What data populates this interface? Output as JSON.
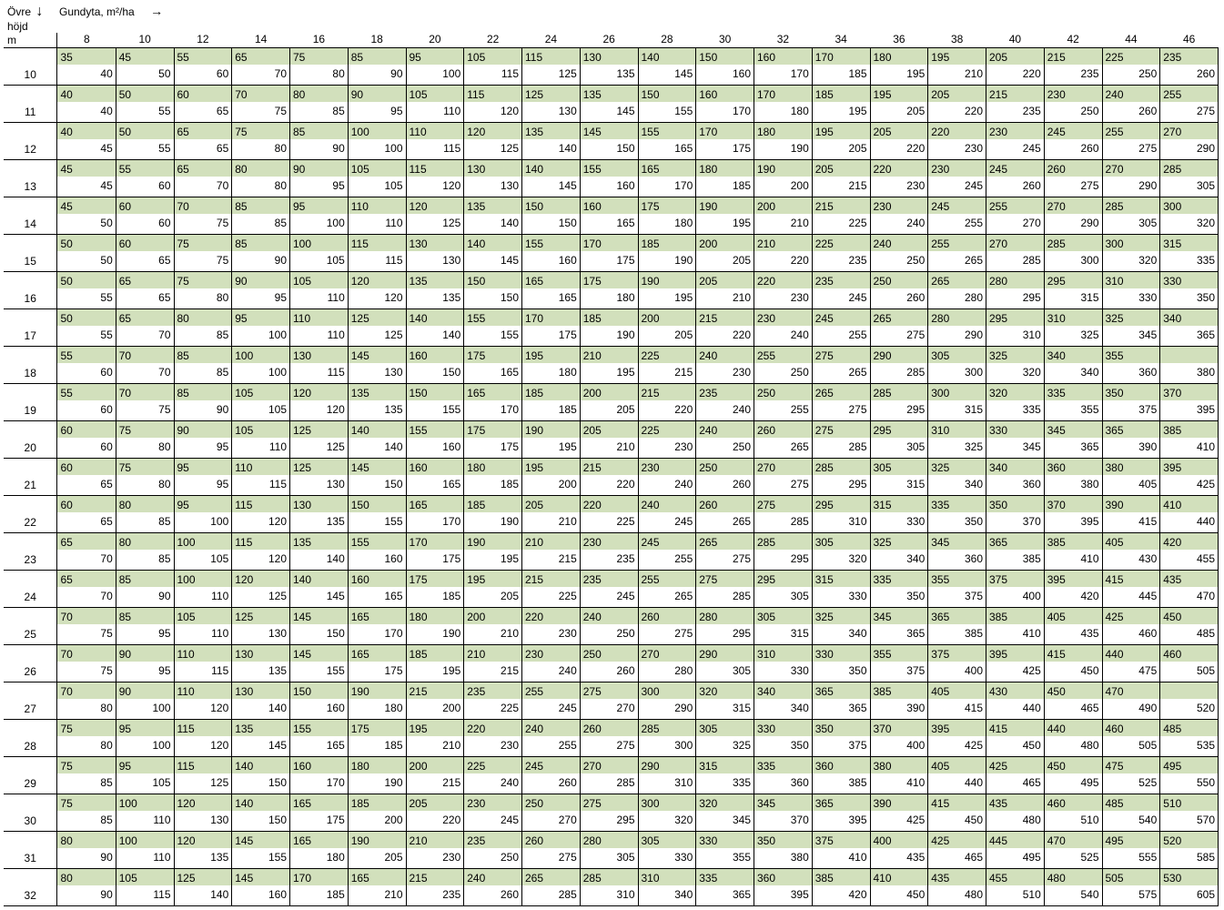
{
  "labels": {
    "y_axis_line1": "Övre",
    "y_axis_line2": "höjd",
    "y_axis_line3": "m",
    "x_axis": "Gundyta, m²/ha"
  },
  "col_headers": [
    8,
    10,
    12,
    14,
    16,
    18,
    20,
    22,
    24,
    26,
    28,
    30,
    32,
    34,
    36,
    38,
    40,
    42,
    44,
    46
  ],
  "row_headers": [
    10,
    11,
    12,
    13,
    14,
    15,
    16,
    17,
    18,
    19,
    20,
    21,
    22,
    23,
    24,
    25,
    26,
    27,
    28,
    29,
    30,
    31,
    32
  ],
  "chart_data": {
    "type": "table",
    "title": "Gundyta, m²/ha",
    "x": [
      8,
      10,
      12,
      14,
      16,
      18,
      20,
      22,
      24,
      26,
      28,
      30,
      32,
      34,
      36,
      38,
      40,
      42,
      44,
      46
    ],
    "y": [
      10,
      11,
      12,
      13,
      14,
      15,
      16,
      17,
      18,
      19,
      20,
      21,
      22,
      23,
      24,
      25,
      26,
      27,
      28,
      29,
      30,
      31,
      32
    ],
    "series": [
      {
        "name": "shaded",
        "data": [
          [
            35,
            45,
            55,
            65,
            75,
            85,
            95,
            105,
            115,
            130,
            140,
            150,
            160,
            170,
            180,
            195,
            205,
            215,
            225,
            235
          ],
          [
            40,
            50,
            60,
            70,
            80,
            90,
            105,
            115,
            125,
            135,
            150,
            160,
            170,
            185,
            195,
            205,
            215,
            230,
            240,
            255
          ],
          [
            40,
            50,
            65,
            75,
            85,
            100,
            110,
            120,
            135,
            145,
            155,
            170,
            180,
            195,
            205,
            220,
            230,
            245,
            255,
            270
          ],
          [
            45,
            55,
            65,
            80,
            90,
            105,
            115,
            130,
            140,
            155,
            165,
            180,
            190,
            205,
            220,
            230,
            245,
            260,
            270,
            285
          ],
          [
            45,
            60,
            70,
            85,
            95,
            110,
            120,
            135,
            150,
            160,
            175,
            190,
            200,
            215,
            230,
            245,
            255,
            270,
            285,
            300
          ],
          [
            50,
            60,
            75,
            85,
            100,
            115,
            130,
            140,
            155,
            170,
            185,
            200,
            210,
            225,
            240,
            255,
            270,
            285,
            300,
            315
          ],
          [
            50,
            65,
            75,
            90,
            105,
            120,
            135,
            150,
            165,
            175,
            190,
            205,
            220,
            235,
            250,
            265,
            280,
            295,
            310,
            330
          ],
          [
            50,
            65,
            80,
            95,
            110,
            125,
            140,
            155,
            170,
            185,
            200,
            215,
            230,
            245,
            265,
            280,
            295,
            310,
            325,
            340
          ],
          [
            55,
            70,
            85,
            100,
            130,
            145,
            160,
            175,
            195,
            210,
            225,
            240,
            255,
            275,
            290,
            305,
            325,
            340,
            355,
            null
          ],
          [
            55,
            70,
            85,
            105,
            120,
            135,
            150,
            165,
            185,
            200,
            215,
            235,
            250,
            265,
            285,
            300,
            320,
            335,
            350,
            370
          ],
          [
            60,
            75,
            90,
            105,
            125,
            140,
            155,
            175,
            190,
            205,
            225,
            240,
            260,
            275,
            295,
            310,
            330,
            345,
            365,
            385
          ],
          [
            60,
            75,
            95,
            110,
            125,
            145,
            160,
            180,
            195,
            215,
            230,
            250,
            270,
            285,
            305,
            325,
            340,
            360,
            380,
            395
          ],
          [
            60,
            80,
            95,
            115,
            130,
            150,
            165,
            185,
            205,
            220,
            240,
            260,
            275,
            295,
            315,
            335,
            350,
            370,
            390,
            410
          ],
          [
            65,
            80,
            100,
            115,
            135,
            155,
            170,
            190,
            210,
            230,
            245,
            265,
            285,
            305,
            325,
            345,
            365,
            385,
            405,
            420
          ],
          [
            65,
            85,
            100,
            120,
            140,
            160,
            175,
            195,
            215,
            235,
            255,
            275,
            295,
            315,
            335,
            355,
            375,
            395,
            415,
            435
          ],
          [
            70,
            85,
            105,
            125,
            145,
            165,
            180,
            200,
            220,
            240,
            260,
            280,
            305,
            325,
            345,
            365,
            385,
            405,
            425,
            450
          ],
          [
            70,
            90,
            110,
            130,
            145,
            165,
            185,
            210,
            230,
            250,
            270,
            290,
            310,
            330,
            355,
            375,
            395,
            415,
            440,
            460
          ],
          [
            70,
            90,
            110,
            130,
            150,
            190,
            215,
            235,
            255,
            275,
            300,
            320,
            340,
            365,
            385,
            405,
            430,
            450,
            470,
            null
          ],
          [
            75,
            95,
            115,
            135,
            155,
            175,
            195,
            220,
            240,
            260,
            285,
            305,
            330,
            350,
            370,
            395,
            415,
            440,
            460,
            485
          ],
          [
            75,
            95,
            115,
            140,
            160,
            180,
            200,
            225,
            245,
            270,
            290,
            315,
            335,
            360,
            380,
            405,
            425,
            450,
            475,
            495
          ],
          [
            75,
            100,
            120,
            140,
            165,
            185,
            205,
            230,
            250,
            275,
            300,
            320,
            345,
            365,
            390,
            415,
            435,
            460,
            485,
            510
          ],
          [
            80,
            100,
            120,
            145,
            165,
            190,
            210,
            235,
            260,
            280,
            305,
            330,
            350,
            375,
            400,
            425,
            445,
            470,
            495,
            520
          ],
          [
            80,
            105,
            125,
            145,
            170,
            165,
            215,
            240,
            265,
            285,
            310,
            335,
            360,
            385,
            410,
            435,
            455,
            480,
            505,
            530
          ]
        ]
      },
      {
        "name": "plain",
        "data": [
          [
            40,
            50,
            60,
            70,
            80,
            90,
            100,
            115,
            125,
            135,
            145,
            160,
            170,
            185,
            195,
            210,
            220,
            235,
            250,
            260
          ],
          [
            40,
            55,
            65,
            75,
            85,
            95,
            110,
            120,
            130,
            145,
            155,
            170,
            180,
            195,
            205,
            220,
            235,
            250,
            260,
            275
          ],
          [
            45,
            55,
            65,
            80,
            90,
            100,
            115,
            125,
            140,
            150,
            165,
            175,
            190,
            205,
            220,
            230,
            245,
            260,
            275,
            290
          ],
          [
            45,
            60,
            70,
            80,
            95,
            105,
            120,
            130,
            145,
            160,
            170,
            185,
            200,
            215,
            230,
            245,
            260,
            275,
            290,
            305
          ],
          [
            50,
            60,
            75,
            85,
            100,
            110,
            125,
            140,
            150,
            165,
            180,
            195,
            210,
            225,
            240,
            255,
            270,
            290,
            305,
            320
          ],
          [
            50,
            65,
            75,
            90,
            105,
            115,
            130,
            145,
            160,
            175,
            190,
            205,
            220,
            235,
            250,
            265,
            285,
            300,
            320,
            335
          ],
          [
            55,
            65,
            80,
            95,
            110,
            120,
            135,
            150,
            165,
            180,
            195,
            210,
            230,
            245,
            260,
            280,
            295,
            315,
            330,
            350
          ],
          [
            55,
            70,
            85,
            100,
            110,
            125,
            140,
            155,
            175,
            190,
            205,
            220,
            240,
            255,
            275,
            290,
            310,
            325,
            345,
            365
          ],
          [
            60,
            70,
            85,
            100,
            115,
            130,
            150,
            165,
            180,
            195,
            215,
            230,
            250,
            265,
            285,
            300,
            320,
            340,
            360,
            380
          ],
          [
            60,
            75,
            90,
            105,
            120,
            135,
            155,
            170,
            185,
            205,
            220,
            240,
            255,
            275,
            295,
            315,
            335,
            355,
            375,
            395
          ],
          [
            60,
            80,
            95,
            110,
            125,
            140,
            160,
            175,
            195,
            210,
            230,
            250,
            265,
            285,
            305,
            325,
            345,
            365,
            390,
            410
          ],
          [
            65,
            80,
            95,
            115,
            130,
            150,
            165,
            185,
            200,
            220,
            240,
            260,
            275,
            295,
            315,
            340,
            360,
            380,
            405,
            425
          ],
          [
            65,
            85,
            100,
            120,
            135,
            155,
            170,
            190,
            210,
            225,
            245,
            265,
            285,
            310,
            330,
            350,
            370,
            395,
            415,
            440
          ],
          [
            70,
            85,
            105,
            120,
            140,
            160,
            175,
            195,
            215,
            235,
            255,
            275,
            295,
            320,
            340,
            360,
            385,
            410,
            430,
            455
          ],
          [
            70,
            90,
            110,
            125,
            145,
            165,
            185,
            205,
            225,
            245,
            265,
            285,
            305,
            330,
            350,
            375,
            400,
            420,
            445,
            470
          ],
          [
            75,
            95,
            110,
            130,
            150,
            170,
            190,
            210,
            230,
            250,
            275,
            295,
            315,
            340,
            365,
            385,
            410,
            435,
            460,
            485
          ],
          [
            75,
            95,
            115,
            135,
            155,
            175,
            195,
            215,
            240,
            260,
            280,
            305,
            330,
            350,
            375,
            400,
            425,
            450,
            475,
            505
          ],
          [
            80,
            100,
            120,
            140,
            160,
            180,
            200,
            225,
            245,
            270,
            290,
            315,
            340,
            365,
            390,
            415,
            440,
            465,
            490,
            520
          ],
          [
            80,
            100,
            120,
            145,
            165,
            185,
            210,
            230,
            255,
            275,
            300,
            325,
            350,
            375,
            400,
            425,
            450,
            480,
            505,
            535
          ],
          [
            85,
            105,
            125,
            150,
            170,
            190,
            215,
            240,
            260,
            285,
            310,
            335,
            360,
            385,
            410,
            440,
            465,
            495,
            525,
            550
          ],
          [
            85,
            110,
            130,
            150,
            175,
            200,
            220,
            245,
            270,
            295,
            320,
            345,
            370,
            395,
            425,
            450,
            480,
            510,
            540,
            570
          ],
          [
            90,
            110,
            135,
            155,
            180,
            205,
            230,
            250,
            275,
            305,
            330,
            355,
            380,
            410,
            435,
            465,
            495,
            525,
            555,
            585
          ],
          [
            90,
            115,
            140,
            160,
            185,
            210,
            235,
            260,
            285,
            310,
            340,
            365,
            395,
            420,
            450,
            480,
            510,
            540,
            575,
            605
          ]
        ]
      }
    ]
  }
}
